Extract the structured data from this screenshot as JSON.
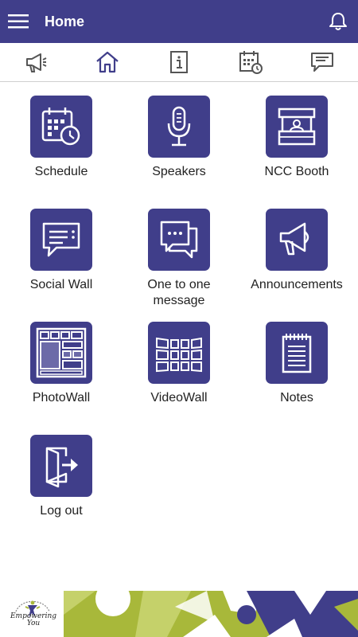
{
  "header": {
    "title": "Home",
    "menu_icon": "hamburger-menu-icon",
    "bell_icon": "bell-icon"
  },
  "tabs": [
    {
      "icon": "megaphone-icon"
    },
    {
      "icon": "home-icon",
      "selected": true
    },
    {
      "icon": "info-icon"
    },
    {
      "icon": "calendar-clock-icon"
    },
    {
      "icon": "chat-icon"
    }
  ],
  "grid": {
    "schedule": "Schedule",
    "speakers": "Speakers",
    "ncc_booth": "NCC Booth",
    "social_wall": "Social Wall",
    "one_to_one": "One to one message",
    "announcements": "Announcements",
    "photowall": "PhotoWall",
    "videowall": "VideoWall",
    "notes": "Notes",
    "logout": "Log out"
  },
  "footer": {
    "logo_text_line1": "Empowering",
    "logo_text_line2": "You"
  },
  "colors": {
    "primary": "#403e8a",
    "accent_green": "#a8b83a",
    "white": "#ffffff"
  }
}
